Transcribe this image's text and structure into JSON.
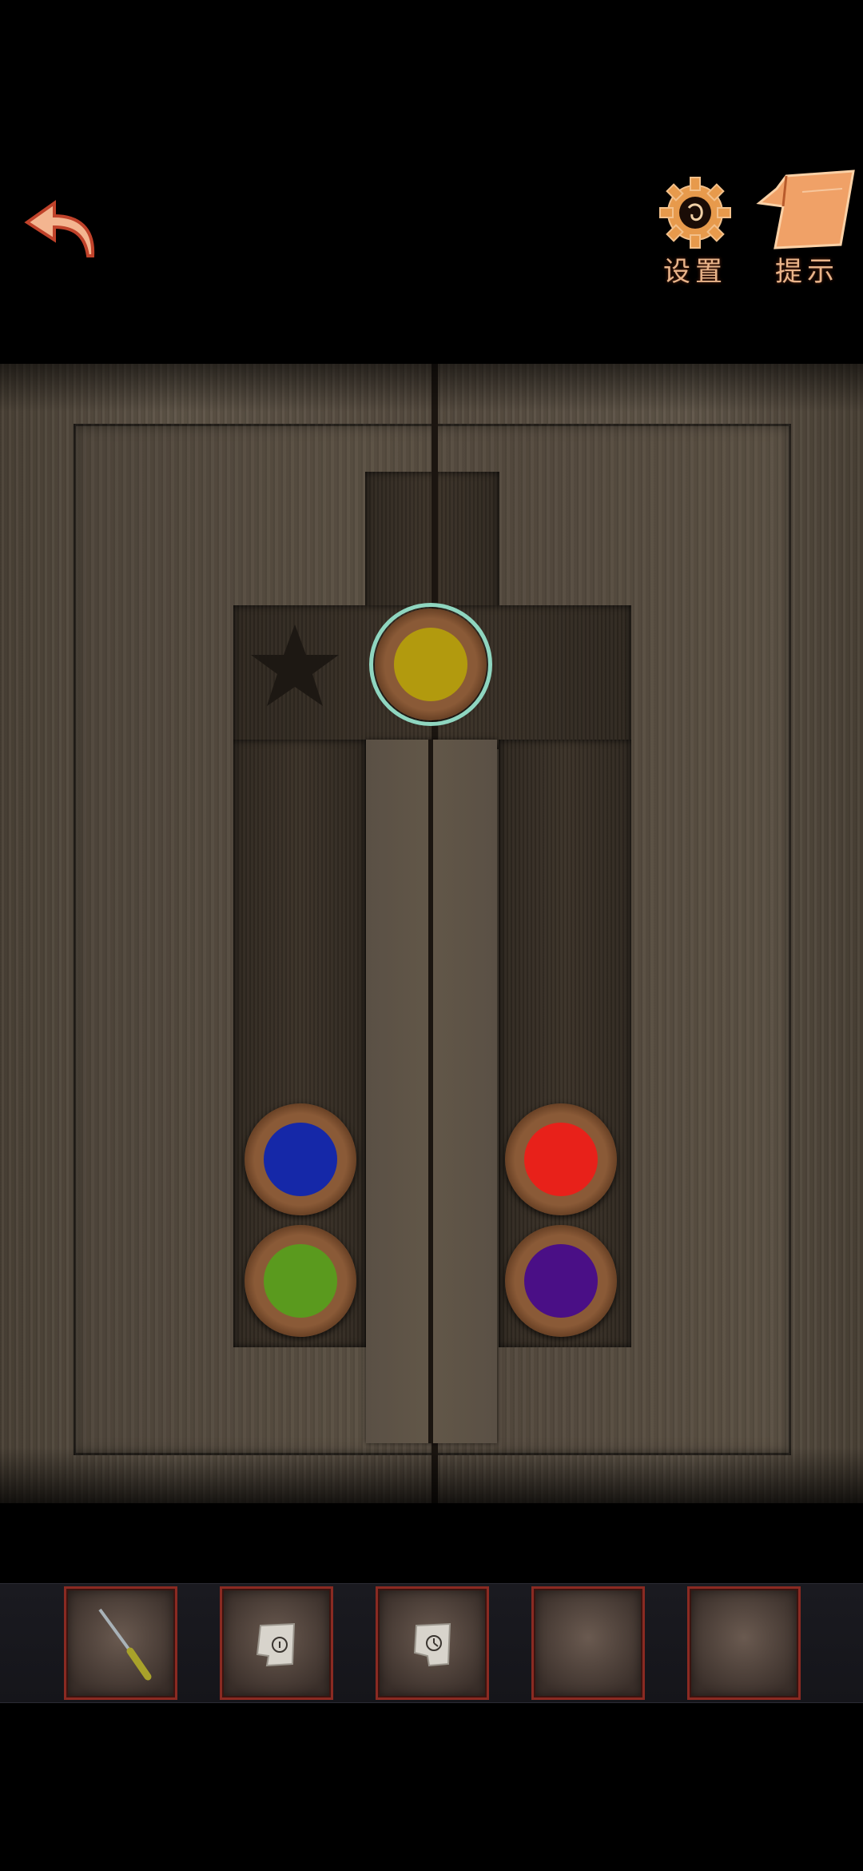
{
  "top_bar": {
    "back_icon": "back-arrow-icon",
    "settings": {
      "label": "设置",
      "icon": "gear-icon"
    },
    "hint": {
      "label": "提示",
      "icon": "note-paper-icon"
    },
    "accent_color": "#e9b48a"
  },
  "puzzle": {
    "star_icon": "star-icon",
    "tokens": [
      {
        "name": "yellow",
        "color": "#b29a0e",
        "selected": true
      },
      {
        "name": "blue",
        "color": "#1528a8",
        "selected": false
      },
      {
        "name": "green",
        "color": "#5a9a1e",
        "selected": false
      },
      {
        "name": "red",
        "color": "#e8211a",
        "selected": false
      },
      {
        "name": "purple",
        "color": "#4a0f86",
        "selected": false
      }
    ],
    "selection_color": "#8fd6c0"
  },
  "inventory": {
    "slots": [
      {
        "item": "knife-icon",
        "filled": true
      },
      {
        "item": "paper-note-icon",
        "filled": true
      },
      {
        "item": "paper-note-clock-icon",
        "filled": true
      },
      {
        "item": "",
        "filled": false
      },
      {
        "item": "",
        "filled": false
      }
    ]
  }
}
